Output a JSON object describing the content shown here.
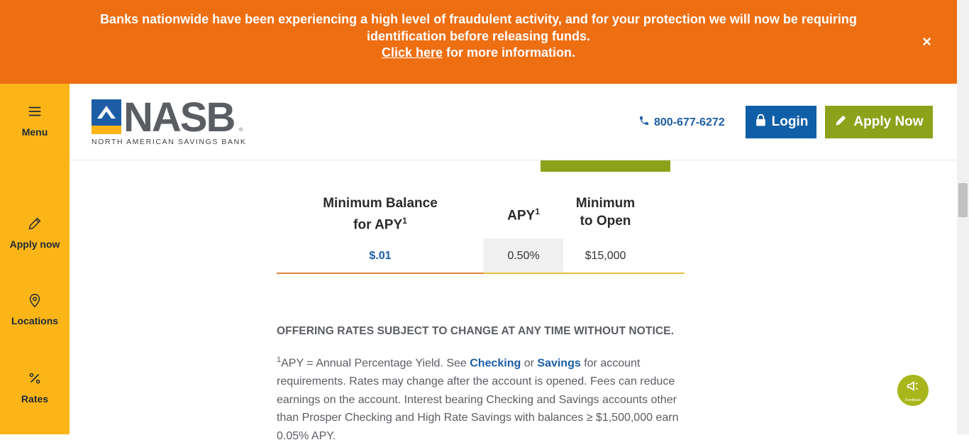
{
  "alert": {
    "line1": "Banks nationwide have been experiencing a high level of fraudulent activity, and for your protection we will now be requiring",
    "line2": "identification before releasing funds.",
    "link_text": "Click here",
    "link_suffix": " for more information.",
    "close_label": "×"
  },
  "sidebar": {
    "items": [
      {
        "label": "Menu",
        "icon": "hamburger-icon"
      },
      {
        "label": "Apply now",
        "icon": "pencil-icon"
      },
      {
        "label": "Locations",
        "icon": "map-pin-icon"
      },
      {
        "label": "Rates",
        "icon": "percent-icon"
      }
    ]
  },
  "header": {
    "logo_text": "NASB",
    "logo_reg": "®",
    "logo_subtitle": "NORTH AMERICAN SAVINGS BANK",
    "phone": "800-677-6272",
    "login_label": "Login",
    "apply_label": "Apply Now"
  },
  "rate_table": {
    "col1_line1": "Minimum Balance",
    "col1_line2": "for APY",
    "col1_sup": "1",
    "col2": "APY",
    "col2_sup": "1",
    "col3_line1": "Minimum",
    "col3_line2": "to Open",
    "row": {
      "min_balance": "$.01",
      "apy": "0.50%",
      "min_open": "$15,000"
    }
  },
  "notice": "OFFERING RATES SUBJECT TO CHANGE AT ANY TIME WITHOUT NOTICE.",
  "footnote": {
    "sup": "1",
    "part1": "APY = Annual Percentage Yield. See ",
    "link1": "Checking",
    "part2": " or ",
    "link2": "Savings",
    "part3": " for account requirements. Rates may change after the account is opened. Fees can reduce earnings on the account. Interest bearing Checking and Savings accounts other than Prosper Checking and High Rate Savings with balances ≥ $1,500,000 earn 0.05% APY."
  },
  "feedback": {
    "label": "Feedback"
  },
  "colors": {
    "alert_bg": "#ee6e12",
    "sidebar_bg": "#fbb517",
    "brand_blue": "#1d5da6",
    "brand_green": "#8da21b"
  }
}
